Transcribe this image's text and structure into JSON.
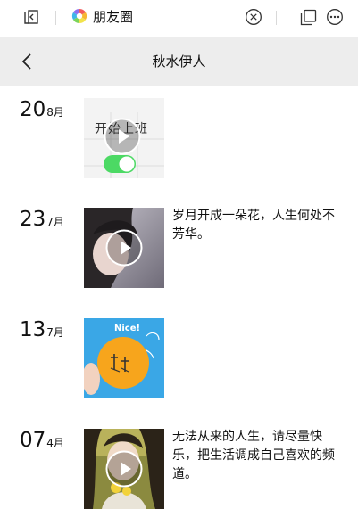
{
  "topbar": {
    "app_name": "朋友圈"
  },
  "navbar": {
    "title": "秋水伊人"
  },
  "posts": [
    {
      "day": "20",
      "month": "8月",
      "thumb_text": "开始上班",
      "text": ""
    },
    {
      "day": "23",
      "month": "7月",
      "text": "岁月开成一朵花，人生何处不芳华。"
    },
    {
      "day": "13",
      "month": "7月",
      "thumb_text": "Nice!",
      "text": ""
    },
    {
      "day": "07",
      "month": "4月",
      "text": "无法从来的人生，请尽量快乐，把生活调成自己喜欢的频道。"
    }
  ],
  "colors": {
    "nav_bg": "#ededed",
    "toggle_green": "#4cd964"
  }
}
